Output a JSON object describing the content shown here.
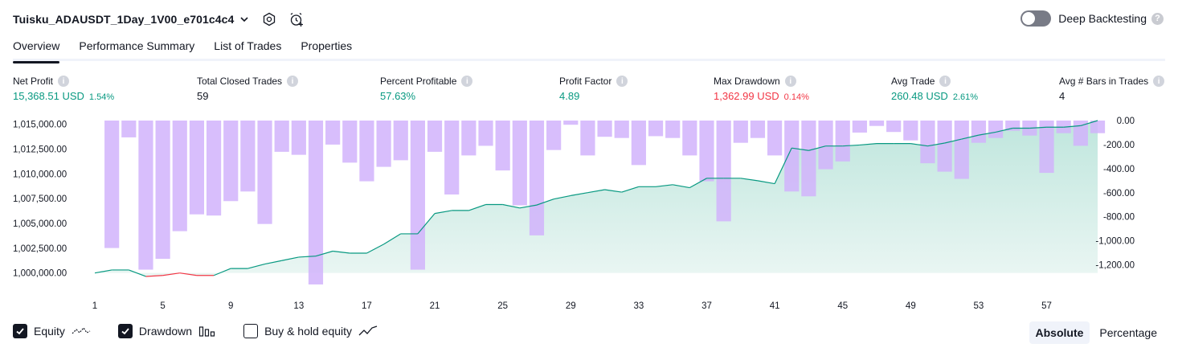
{
  "strategy": {
    "name": "Tuisku_ADAUSDT_1Day_1V00_e701c4c4"
  },
  "deep_backtesting": {
    "label": "Deep Backtesting",
    "enabled": false,
    "help": "?"
  },
  "tabs": [
    {
      "label": "Overview",
      "active": true
    },
    {
      "label": "Performance Summary",
      "active": false
    },
    {
      "label": "List of Trades",
      "active": false
    },
    {
      "label": "Properties",
      "active": false
    }
  ],
  "metrics": {
    "net_profit": {
      "label": "Net Profit",
      "value": "15,368.51 USD",
      "pct": "1.54%"
    },
    "total_closed_trades": {
      "label": "Total Closed Trades",
      "value": "59"
    },
    "percent_profitable": {
      "label": "Percent Profitable",
      "value": "57.63%"
    },
    "profit_factor": {
      "label": "Profit Factor",
      "value": "4.89"
    },
    "max_drawdown": {
      "label": "Max Drawdown",
      "value": "1,362.99 USD",
      "pct": "0.14%"
    },
    "avg_trade": {
      "label": "Avg Trade",
      "value": "260.48 USD",
      "pct": "2.61%"
    },
    "avg_bars": {
      "label": "Avg # Bars in Trades",
      "value": "4"
    }
  },
  "info_icon": "i",
  "chart_data": {
    "type": "area",
    "x_ticks": [
      "1",
      "5",
      "9",
      "13",
      "17",
      "21",
      "25",
      "29",
      "33",
      "37",
      "41",
      "45",
      "49",
      "53",
      "57"
    ],
    "y_left_ticks": [
      "1,015,000.00",
      "1,012,500.00",
      "1,010,000.00",
      "1,007,500.00",
      "1,005,000.00",
      "1,002,500.00",
      "1,000,000.00"
    ],
    "y_right_ticks": [
      "0.00",
      "-200.00",
      "-400.00",
      "-600.00",
      "-800.00",
      "-1,000.00",
      "-1,200.00"
    ],
    "ylim_left": [
      999000,
      1015368.51
    ],
    "ylim_right": [
      -1350,
      0
    ],
    "x_range": [
      1,
      60
    ],
    "colors": {
      "equity_up": "#089981",
      "equity_down": "#f23645",
      "area_top": "#bfe6dd",
      "area_bottom": "#eaf6f3",
      "drawdown": "#d1b3fb",
      "drawdown_overlap": "#a9b4e8"
    },
    "series": [
      {
        "name": "Equity",
        "x": [
          1,
          2,
          3,
          4,
          5,
          6,
          7,
          8,
          9,
          10,
          11,
          12,
          13,
          14,
          15,
          16,
          17,
          18,
          19,
          20,
          21,
          22,
          23,
          24,
          25,
          26,
          27,
          28,
          29,
          30,
          31,
          32,
          33,
          34,
          35,
          36,
          37,
          38,
          39,
          40,
          41,
          42,
          43,
          44,
          45,
          46,
          47,
          48,
          49,
          50,
          51,
          52,
          53,
          54,
          55,
          56,
          57,
          58,
          59,
          60
        ],
        "values": [
          1000000,
          1000300,
          1000300,
          999650,
          999750,
          1000000,
          999750,
          999750,
          1000450,
          1000450,
          1000900,
          1001250,
          1001600,
          1001700,
          1002200,
          1002000,
          1002000,
          1002900,
          1003950,
          1003950,
          1006000,
          1006300,
          1006300,
          1006900,
          1006900,
          1006550,
          1006850,
          1007450,
          1007800,
          1008100,
          1008400,
          1008150,
          1008700,
          1008700,
          1008900,
          1008600,
          1009550,
          1009550,
          1009550,
          1009300,
          1009000,
          1012600,
          1012350,
          1012800,
          1012800,
          1012900,
          1013050,
          1013050,
          1013050,
          1012800,
          1013100,
          1013500,
          1013900,
          1014200,
          1014600,
          1014600,
          1014700,
          1014700,
          1014850,
          1015368.51
        ]
      },
      {
        "name": "Drawdown",
        "x": [
          1,
          2,
          3,
          4,
          5,
          6,
          7,
          8,
          9,
          10,
          11,
          12,
          13,
          14,
          15,
          16,
          17,
          18,
          19,
          20,
          21,
          22,
          23,
          24,
          25,
          26,
          27,
          28,
          29,
          30,
          31,
          32,
          33,
          34,
          35,
          36,
          37,
          38,
          39,
          40,
          41,
          42,
          43,
          44,
          45,
          46,
          47,
          48,
          49,
          50,
          51,
          52,
          53,
          54,
          55,
          56,
          57,
          58,
          59,
          60
        ],
        "values": [
          0,
          -1060,
          -140,
          -1240,
          -1150,
          -920,
          -780,
          -790,
          -670,
          -590,
          -860,
          -260,
          -285,
          -1363,
          -200,
          -350,
          -505,
          -385,
          -330,
          -1240,
          -260,
          -615,
          -290,
          -210,
          -415,
          -705,
          -955,
          -245,
          -35,
          -290,
          -135,
          -145,
          -370,
          -130,
          -145,
          -290,
          -505,
          -838,
          -185,
          -145,
          -290,
          -590,
          -630,
          -405,
          -340,
          -100,
          -45,
          -95,
          -165,
          -355,
          -425,
          -485,
          -185,
          -145,
          -85,
          -125,
          -435,
          -105,
          -210,
          -105
        ]
      }
    ]
  },
  "legend": {
    "equity": {
      "label": "Equity",
      "checked": true
    },
    "drawdown": {
      "label": "Drawdown",
      "checked": true
    },
    "buy_hold": {
      "label": "Buy & hold equity",
      "checked": false
    }
  },
  "mode": {
    "absolute": "Absolute",
    "percentage": "Percentage"
  }
}
